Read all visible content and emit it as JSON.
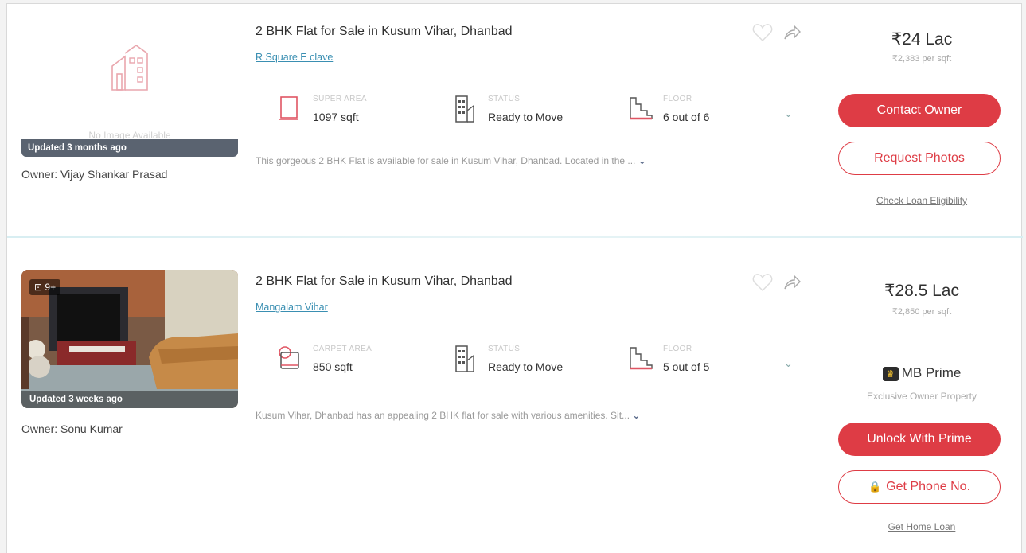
{
  "listings": [
    {
      "title": "2 BHK Flat for Sale in Kusum Vihar, Dhanbad",
      "project": "R Square E clave",
      "no_image_text": "No Image Available",
      "updated": "Updated 3 months ago",
      "owner": "Owner: Vijay Shankar Prasad",
      "area_label": "SUPER AREA",
      "area_value": "1097 sqft",
      "status_label": "STATUS",
      "status_value": "Ready to Move",
      "floor_label": "FLOOR",
      "floor_value": "6 out of 6",
      "description": "This gorgeous 2 BHK Flat is available for sale in Kusum Vihar, Dhanbad. Located in the ...",
      "price": "₹24 Lac",
      "price_per_sqft": "₹2,383 per sqft",
      "primary_button": "Contact Owner",
      "secondary_button": "Request Photos",
      "footer_link": "Check Loan Eligibility"
    },
    {
      "title": "2 BHK Flat for Sale in Kusum Vihar, Dhanbad",
      "project": "Mangalam Vihar",
      "photo_count": "9+",
      "updated": "Updated 3 weeks ago",
      "owner": "Owner: Sonu Kumar",
      "area_label": "CARPET AREA",
      "area_value": "850 sqft",
      "status_label": "STATUS",
      "status_value": "Ready to Move",
      "floor_label": "FLOOR",
      "floor_value": "5 out of 5",
      "description": "Kusum Vihar, Dhanbad has an appealing 2 BHK flat for sale with various amenities. Sit...",
      "price": "₹28.5 Lac",
      "price_per_sqft": "₹2,850 per sqft",
      "prime_label": "MB Prime",
      "prime_sub": "Exclusive Owner Property",
      "primary_button": "Unlock With Prime",
      "secondary_button": "Get Phone No.",
      "footer_link": "Get Home Loan"
    }
  ],
  "colors": {
    "accent": "#de3c45",
    "link": "#3a8fb2",
    "badge": "#5a6370"
  }
}
